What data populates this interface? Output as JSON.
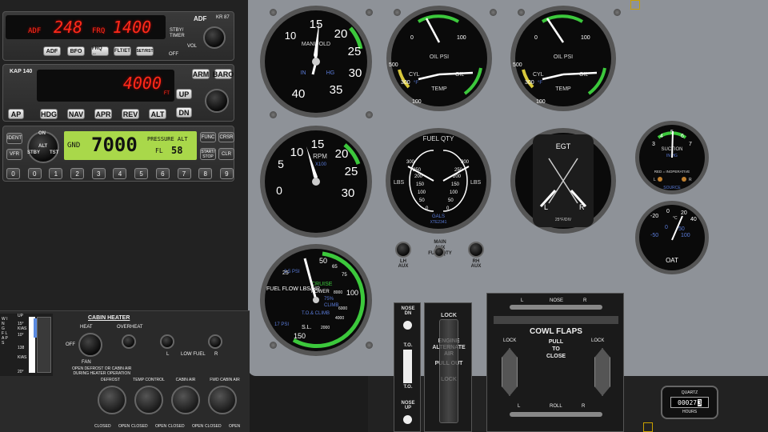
{
  "adf": {
    "mode": "ADF",
    "active_freq": "248",
    "frq_label": "FRQ",
    "standby_freq": "1400",
    "brand": "ADF",
    "model": "KR 87",
    "stby_timer": "STBY/\nTIMER",
    "vol": "VOL",
    "off": "OFF",
    "buttons": [
      "ADF",
      "BFO",
      "FRQ ↔",
      "FLT/ET",
      "SET/RST"
    ]
  },
  "autopilot": {
    "model": "KAP 140",
    "altitude": "4000",
    "unit": "FT",
    "arm": "ARM",
    "baro": "BARO",
    "up": "UP",
    "dn": "DN",
    "buttons": [
      "AP",
      "HDG",
      "NAV",
      "APR",
      "REV",
      "ALT"
    ]
  },
  "transponder": {
    "ident": "IDENT",
    "vfr": "VFR",
    "on": "ON",
    "alt": "ALT",
    "stby": "STBY",
    "tst": "TST",
    "mode": "GND",
    "squawk": "7000",
    "pressure_alt": "PRESSURE ALT",
    "fl_label": "FL",
    "fl_value": "58",
    "func": "FUNC",
    "crsr": "CRSR",
    "start_stop": "START/\nSTOP",
    "clr": "CLR",
    "digits": [
      "0",
      "0",
      "1",
      "2",
      "3",
      "4",
      "5",
      "6",
      "7",
      "8",
      "9"
    ]
  },
  "manifold": {
    "label": "MANIFOLD",
    "in": "IN",
    "hg": "HG",
    "ticks": [
      "10",
      "15",
      "20",
      "25",
      "30",
      "35",
      "40"
    ]
  },
  "rpm": {
    "label": "RPM",
    "sub": "X100",
    "ticks": [
      "0",
      "5",
      "10",
      "15",
      "20",
      "25",
      "30"
    ]
  },
  "oil_left": {
    "oil_psi": "OIL PSI",
    "cyl": "CYL",
    "oil": "OIL",
    "temp": "TEMP",
    "t0": "0",
    "t100": "100",
    "t500": "500",
    "t300": "300",
    "t100b": "100",
    "unit": "°F"
  },
  "oil_right": {
    "oil_psi": "OIL PSI",
    "cyl": "CYL",
    "oil": "OIL",
    "temp": "TEMP",
    "t0": "0",
    "t100": "100",
    "t500": "500",
    "t300": "300",
    "t100b": "100",
    "unit": "°F"
  },
  "fuel_qty": {
    "title": "FUEL QTY",
    "lbs_left": "LBS",
    "lbs_right": "LBS",
    "gals": "GALS",
    "part": "XTE2341",
    "left_ticks": [
      "300",
      "250",
      "200",
      "150",
      "100",
      "50",
      "0"
    ],
    "right_ticks": [
      "300",
      "250",
      "200",
      "150",
      "100",
      "50",
      "0"
    ],
    "gal_ticks": [
      "40",
      "30",
      "20",
      "10",
      "0"
    ]
  },
  "egt": {
    "label": "EGT",
    "left": "L",
    "right": "R",
    "note": "25°F/DIV"
  },
  "suction": {
    "label": "SUCTION",
    "sub": "IN HG",
    "note": "RED = INOPERATIVE",
    "source": "SOURCE",
    "l": "L",
    "r": "R",
    "ticks": [
      "3",
      "4",
      "5",
      "6",
      "7"
    ]
  },
  "oat": {
    "label": "OAT",
    "ticks_c": [
      "-20",
      "0",
      "20",
      "40"
    ],
    "ticks_f": [
      "-50",
      "0",
      "50",
      "100"
    ],
    "unit": "°C"
  },
  "fuel_flow": {
    "label": "FUEL\nFLOW\nLBS/HR",
    "ticks": [
      "25",
      "50",
      "65",
      "75",
      "100",
      "150"
    ],
    "psi": "2.5 PSI",
    "psi2": "17 PSI",
    "cruise": "CRUISE",
    "power": "POWER",
    "pct": "75%",
    "climb": "CLIMB",
    "to_climb": "T.O.& CLIMB",
    "sl": "S.L.",
    "alts": [
      "8000",
      "6000",
      "4000",
      "2000"
    ],
    "dots_labels": [
      "45",
      "65",
      "75"
    ]
  },
  "aux_switches": [
    {
      "label": "LH\nAUX"
    },
    {
      "label": "MAIN\nAUX\nFUEL QTY"
    },
    {
      "label": "RH\nAUX"
    }
  ],
  "cabin_heater": {
    "title": "CABIN HEATER",
    "heat": "HEAT",
    "overheat": "OVERHEAT",
    "off": "OFF",
    "fan": "FAN",
    "l": "L",
    "low_fuel": "LOW FUEL",
    "r": "R",
    "note": "OPEN DEFROST OR CABIN AIR\nDURING HEATER OPERATION"
  },
  "wing_flaps": {
    "label": "W I N G F L A P S",
    "up": "UP",
    "f1": "15°\nKIAS",
    "f2": "10°",
    "f3": "138",
    "f4": "KIAS",
    "f5": "20°"
  },
  "vents": [
    {
      "title": "DEFROST",
      "closed": "CLOSED",
      "open": "OPEN"
    },
    {
      "title": "TEMP CONTROL",
      "closed": "CLOSED",
      "open": "OPEN"
    },
    {
      "title": "CABIN AIR",
      "closed": "CLOSED",
      "open": "OPEN"
    },
    {
      "title": "FWD CABIN AIR",
      "closed": "CLOSED",
      "open": "OPEN"
    }
  ],
  "trim": {
    "nose_dn": "NOSE\nDN",
    "to": "T.O.",
    "to2": "T.O.",
    "nose_up": "NOSE\nUP"
  },
  "alternate_air": {
    "lock": "LOCK",
    "engine": "ENGINE\nALTERNATE\nAIR",
    "pull": "PULL OUT",
    "lock2": "LOCK"
  },
  "cowl_flaps": {
    "l": "L",
    "nose": "NOSE",
    "r": "R",
    "title": "COWL FLAPS",
    "lock_l": "LOCK",
    "pull": "PULL\nTO\nCLOSE",
    "lock_r": "LOCK",
    "l2": "L",
    "roll": "ROLL",
    "r2": "R"
  },
  "hobbs": {
    "label": "QUARTZ",
    "digits": "00027",
    "tenth": "3",
    "unit": "HOURS"
  }
}
